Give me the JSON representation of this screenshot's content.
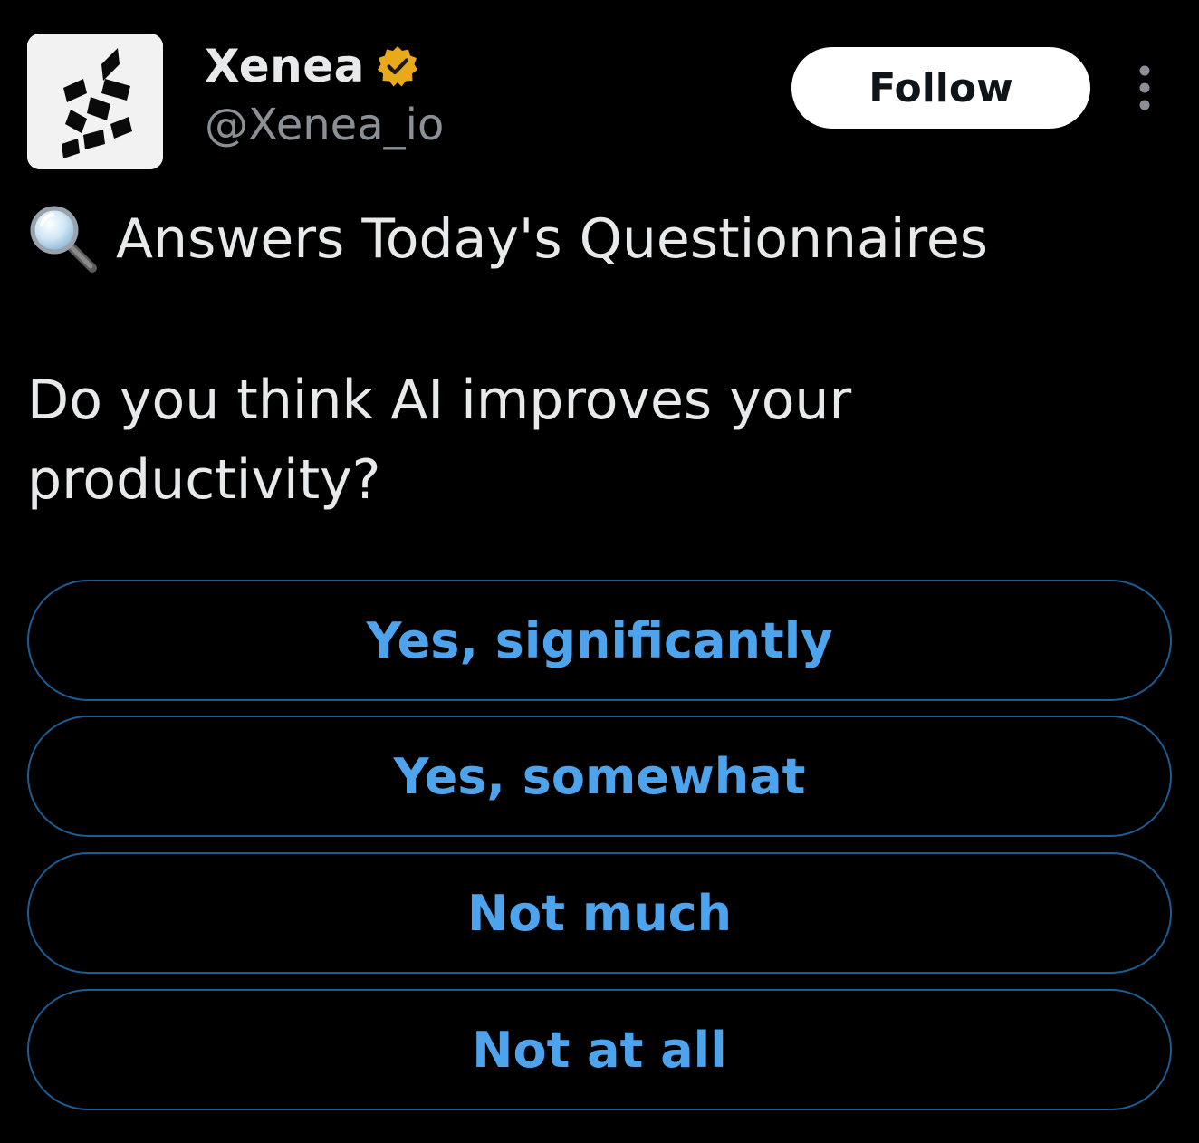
{
  "colors": {
    "background": "#000000",
    "text_primary": "#e7e9ea",
    "text_secondary": "#8b9096",
    "poll_accent": "#4ea4ec",
    "poll_border": "#1d5c93",
    "verified_badge": "#e8a91b",
    "follow_bg": "#ffffff"
  },
  "post": {
    "author": {
      "display_name": "Xenea",
      "handle": "@Xenea_io",
      "avatar_icon": "xenea-logo-icon",
      "verified_icon": "verified-badge-icon"
    },
    "follow_label": "Follow",
    "more_icon": "more-vertical-icon",
    "intro_icon": "magnifying-glass-icon",
    "intro_text": "Answers Today's Questionnaires",
    "question": "Do you think AI improves your productivity?"
  },
  "poll": {
    "options": [
      {
        "label": "Yes, significantly"
      },
      {
        "label": "Yes, somewhat"
      },
      {
        "label": "Not much"
      },
      {
        "label": "Not at all"
      }
    ]
  }
}
